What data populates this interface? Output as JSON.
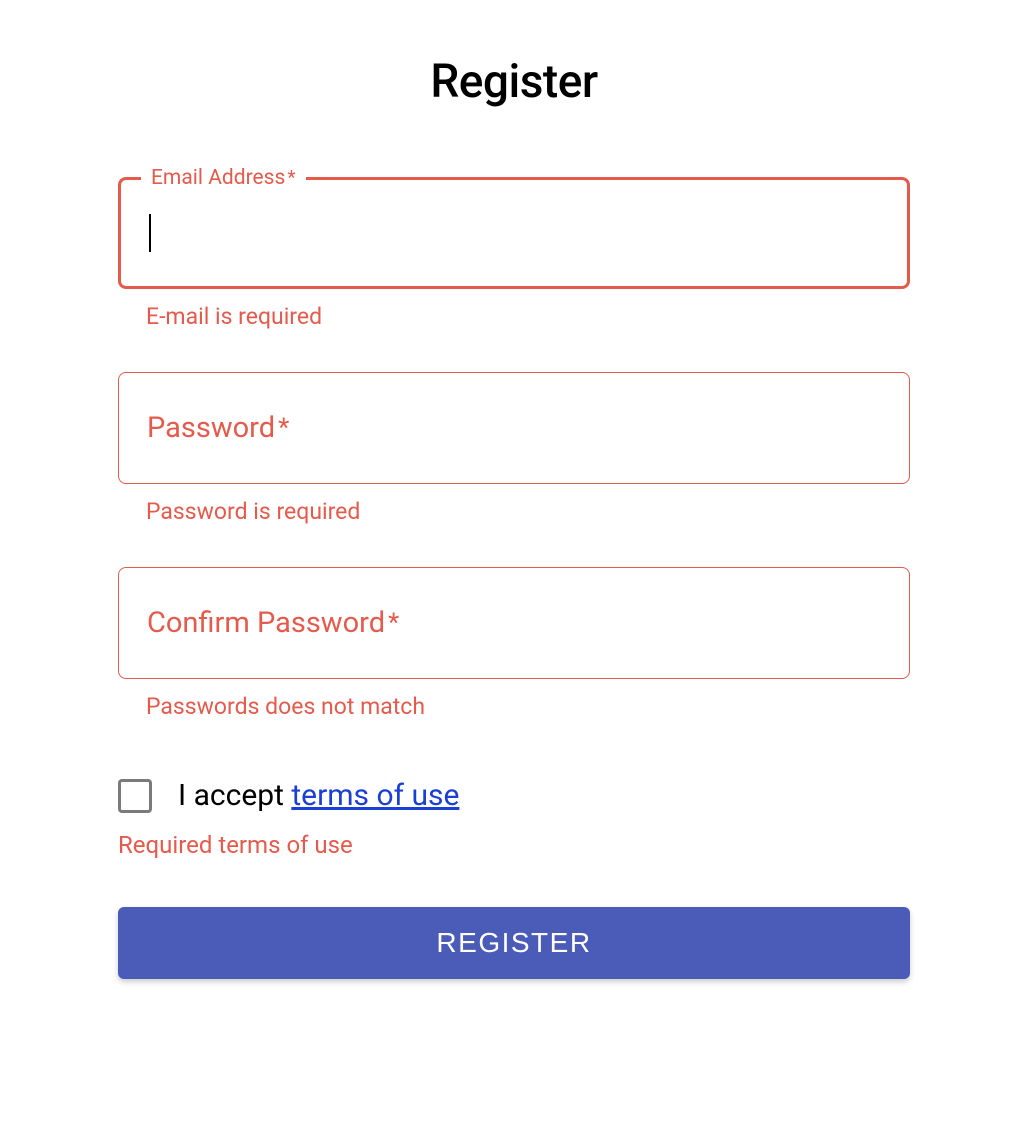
{
  "title": "Register",
  "fields": {
    "email": {
      "label": "Email Address",
      "required_mark": "*",
      "value": "",
      "error": "E-mail is required"
    },
    "password": {
      "label": "Password",
      "required_mark": "*",
      "value": "",
      "error": "Password is required"
    },
    "confirm_password": {
      "label": "Confirm Password",
      "required_mark": "*",
      "value": "",
      "error": "Passwords does not match"
    }
  },
  "terms": {
    "prefix": "I accept ",
    "link_text": "terms of use",
    "error": "Required terms of use"
  },
  "submit": {
    "label": "REGISTER"
  },
  "colors": {
    "error": "#e65a4b",
    "primary": "#4a5bb8",
    "link": "#1a3fd4"
  }
}
